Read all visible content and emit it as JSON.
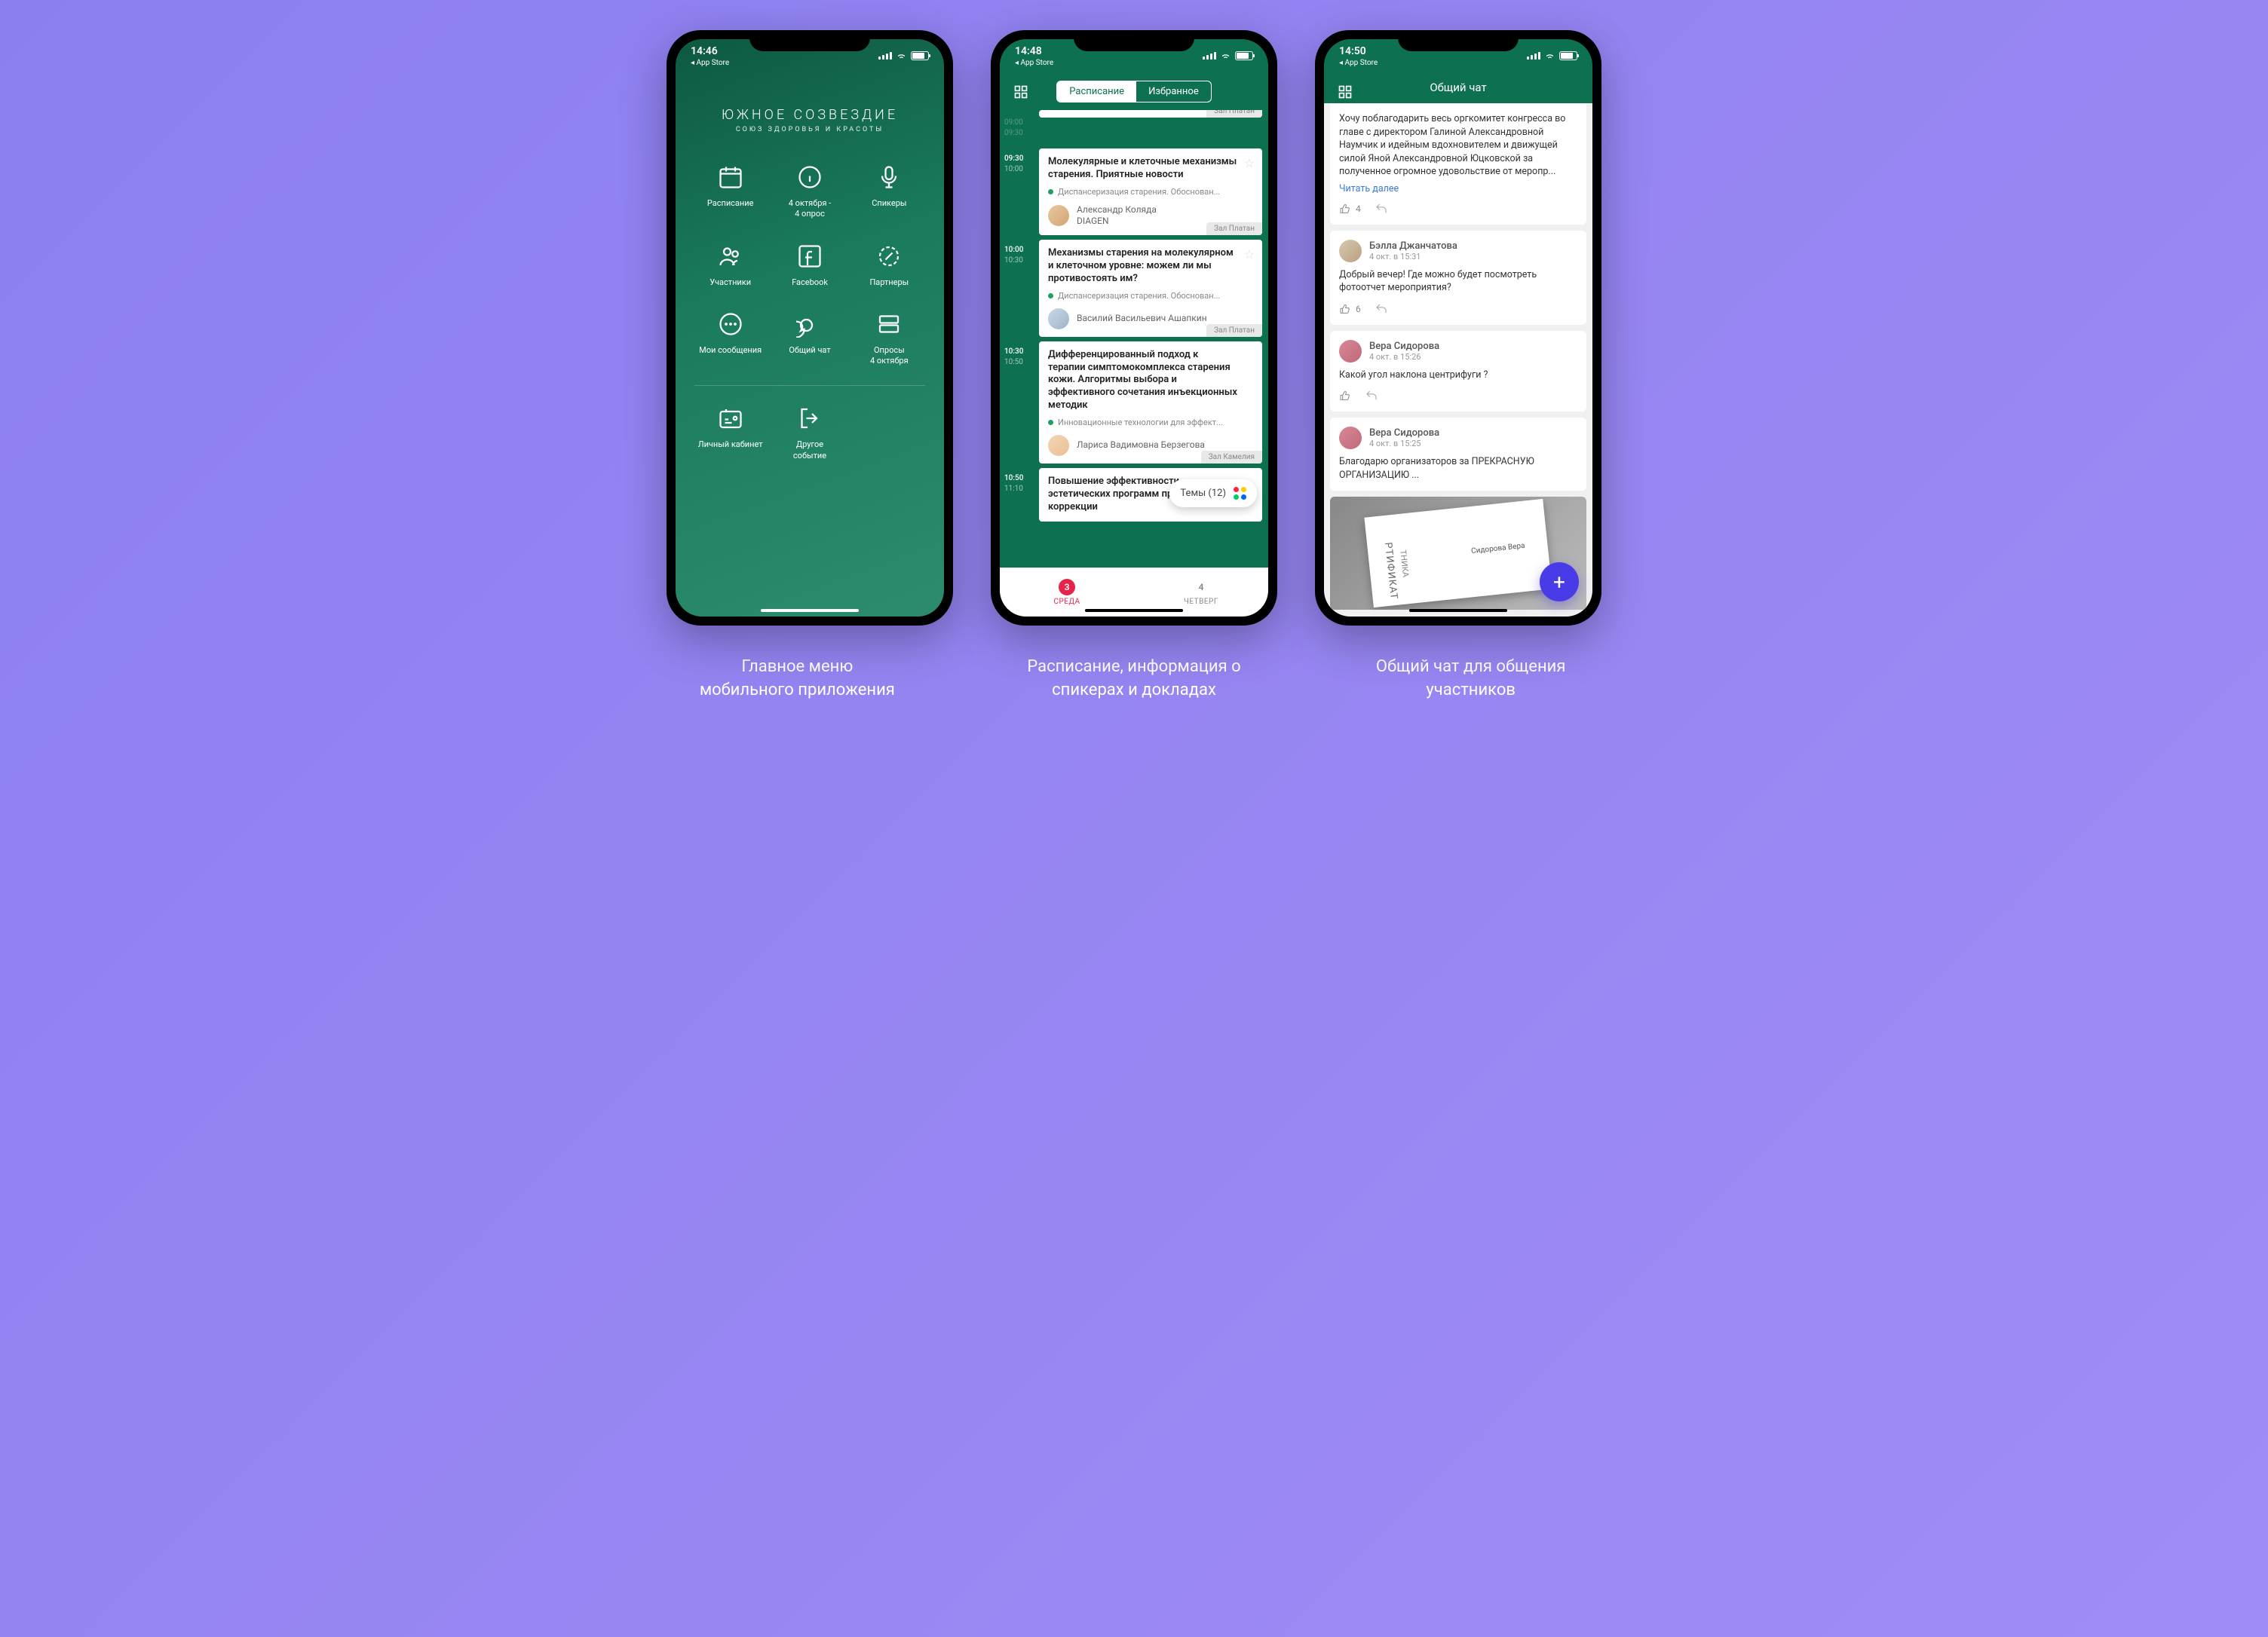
{
  "status": {
    "time1": "14:46",
    "time2": "14:48",
    "time3": "14:50",
    "back": "◂ App Store"
  },
  "s1": {
    "logo_main": "ЮЖНОЕ СОЗВЕЗДИЕ",
    "logo_sub": "СОЮЗ ЗДОРОВЬЯ И КРАСОТЫ",
    "menu": {
      "schedule": "Расписание",
      "poll": "4 октября -\n4 опрос",
      "speakers": "Спикеры",
      "participants": "Участники",
      "facebook": "Facebook",
      "partners": "Партнеры",
      "messages": "Мои сообщения",
      "chat": "Общий чат",
      "polls": "Опросы\n4 октября",
      "account": "Личный кабинет",
      "other": "Другое\nсобытие"
    }
  },
  "s2": {
    "tab1": "Расписание",
    "tab2": "Избранное",
    "room": "Зал Платан",
    "room2": "Зал Камелия",
    "themes": "Темы (12)",
    "e1": {
      "t1": "09:30",
      "t2": "10:00",
      "title": "Молекулярные и клеточные механизмы старения. Приятные новости",
      "tag": "Диспансеризация старения. Обоснован...",
      "speaker": "Александр Коляда",
      "org": "DIAGEN"
    },
    "e2": {
      "t1": "10:00",
      "t2": "10:30",
      "title": "Механизмы старения на молекулярном и клеточном уровне: можем ли мы противостоять им?",
      "tag": "Диспансеризация старения. Обоснован...",
      "speaker": "Василий Васильевич Ашапкин"
    },
    "e3": {
      "t1": "10:30",
      "t2": "10:50",
      "title": "Дифференцированный подход к терапии симптомокомплекса старения кожи. Алгоритмы выбора и эффективного сочетания инъекционных методик",
      "tag": "Инновационные технологии для эффект...",
      "speaker": "Лариса Вадимовна Берзегова"
    },
    "e4": {
      "t1": "10:50",
      "t2": "11:10",
      "title": "Повышение эффективности эстетических программ профилактики и коррекции"
    },
    "prev": {
      "t1": "09:00",
      "t2": "09:30"
    },
    "nav": {
      "d1n": "3",
      "d1l": "СРЕДА",
      "d2n": "4",
      "d2l": "ЧЕТВЕРГ"
    }
  },
  "s3": {
    "title": "Общий чат",
    "m1": {
      "text": "Хочу поблагодарить весь оргкомитет конгресса во главе с директором Галиной Александровной Наумчик и идейным вдохновителем и движущей силой Яной Александровной Юцковской за полученное огромное удовольствие от меропр...",
      "more": "Читать далее",
      "likes": "4"
    },
    "m2": {
      "name": "Бэлла Джанчатова",
      "time": "4 окт. в 15:31",
      "text": "Добрый вечер! Где можно будет посмотреть фотоотчет мероприятия?",
      "likes": "6"
    },
    "m3": {
      "name": "Вера Сидорова",
      "time": "4 окт. в 15:26",
      "text": "Какой угол наклона центрифуги ?"
    },
    "m4": {
      "name": "Вера Сидорова",
      "time": "4 окт. в 15:25",
      "text": "Благодарю организаторов за ПРЕКРАСНУЮ ОРГАНИЗАЦИЮ ..."
    },
    "cert": {
      "title": "РТИФИКАТ",
      "sub": "ТНИКА",
      "name": "Сидорова Вера"
    }
  },
  "captions": {
    "c1": "Главное меню\nмобильного приложения",
    "c2": "Расписание, информация о\nспикерах и докладах",
    "c3": "Общий чат для общения\nучастников"
  }
}
